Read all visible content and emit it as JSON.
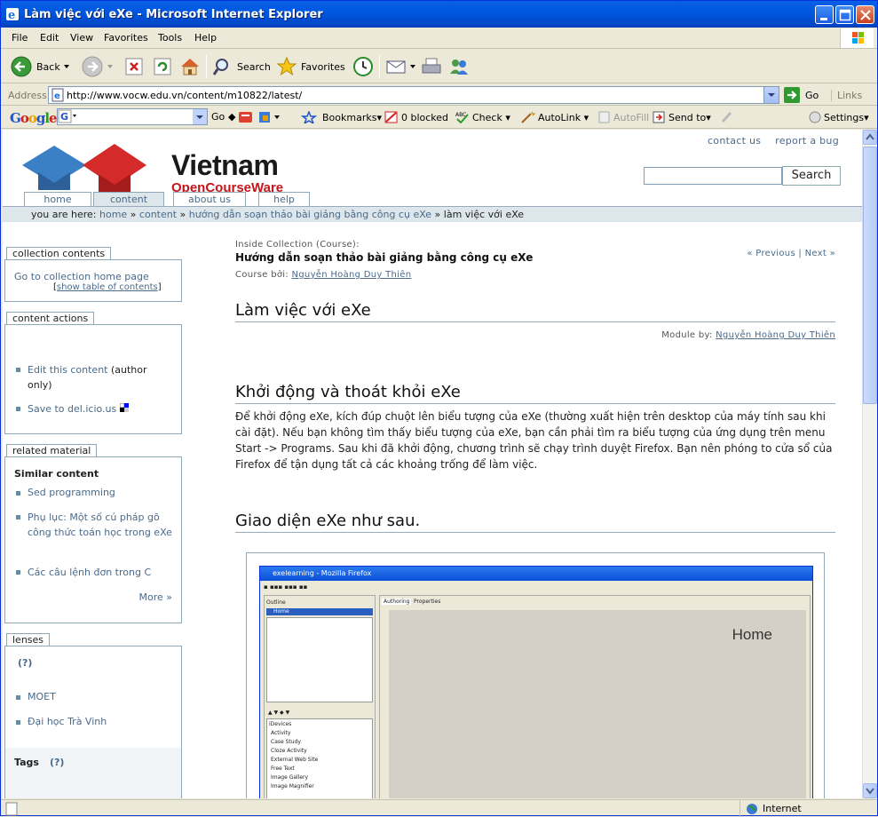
{
  "window": {
    "title": "Làm việc với eXe - Microsoft Internet Explorer"
  },
  "menu": [
    "File",
    "Edit",
    "View",
    "Favorites",
    "Tools",
    "Help"
  ],
  "toolbar": {
    "back": "Back",
    "search": "Search",
    "favorites": "Favorites"
  },
  "address": {
    "label": "Address",
    "url": "http://www.vocw.edu.vn/content/m10822/latest/",
    "go": "Go",
    "links": "Links"
  },
  "google_bar": {
    "logo": "Google",
    "go": "Go",
    "bookmarks": "Bookmarks",
    "blocked": "0 blocked",
    "check": "Check",
    "autolink": "AutoLink",
    "autofill": "AutoFill",
    "sendto": "Send to",
    "settings": "Settings"
  },
  "site": {
    "logo_title": "Vietnam",
    "logo_subtitle": "OpenCourseWare",
    "top_links": [
      "contact us",
      "report a bug"
    ],
    "search_button": "Search",
    "tabs": [
      "home",
      "content",
      "about us",
      "help"
    ],
    "breadcrumb": {
      "prefix": "you are here:",
      "items": [
        "home",
        "content",
        "hướng dẫn soạn thảo bài giảng bằng công cụ eXe"
      ],
      "current": "làm việc với eXe"
    }
  },
  "sidebar": {
    "collection_title": "collection contents",
    "collection_home": "Go to collection home page",
    "show_toc": "show table of contents",
    "actions_title": "content actions",
    "edit_content": "Edit this content",
    "edit_note": "(author only)",
    "save_delicious": "Save to del.icio.us",
    "related_title": "related material",
    "similar_heading": "Similar content",
    "similar_items": [
      "Sed programming",
      "Phụ lục: Một số cú pháp gõ công thức toán học trong eXe",
      "Các câu lệnh đơn trong C"
    ],
    "more": "More »",
    "lenses_title": "lenses",
    "lenses_help": "(?)",
    "lenses_items": [
      "MOET",
      "Đại học Trà Vinh"
    ],
    "tags_label": "Tags",
    "tags_help": "(?)"
  },
  "main": {
    "inside_label": "Inside Collection (Course):",
    "collection_title": "Hướng dẫn soạn thảo bài giảng bằng công cụ eXe",
    "previous": "« Previous",
    "next": "Next »",
    "course_by_label": "Course bởi:",
    "course_author": "Nguyễn Hoàng Duy Thiên",
    "page_title": "Làm việc với eXe",
    "module_by_label": "Module by:",
    "module_author": "Nguyễn Hoàng Duy Thiên",
    "section1_title": "Khởi động và thoát khỏi eXe",
    "section1_text": "Để khởi động eXe, kích đúp chuột lên biểu tượng của eXe (thường xuất hiện trên desktop của máy tính sau khi cài đặt). Nếu bạn không tìm thấy biểu tượng của eXe, bạn cần phải tìm ra biểu tượng của ứng dụng trên menu Start -> Programs. Sau khi đã khởi động, chương trình sẽ chạy trình duyệt Firefox. Bạn nên phóng to cửa sổ của Firefox để tận dụng tất cả các khoảng trống để làm việc.",
    "section2_title": "Giao diện eXe như sau.",
    "screenshot": {
      "title": "exelearning - Mozilla Firefox",
      "tabs": [
        "Authoring",
        "Properties"
      ],
      "outline_label": "Outline",
      "home_node": "Home",
      "home_heading": "Home",
      "idevices_label": "iDevices",
      "idevices": [
        "Activity",
        "Case Study",
        "Cloze Activity",
        "External Web Site",
        "Free Text",
        "Image Gallery",
        "Image Magnifier"
      ]
    }
  },
  "status": {
    "zone": "Internet"
  }
}
